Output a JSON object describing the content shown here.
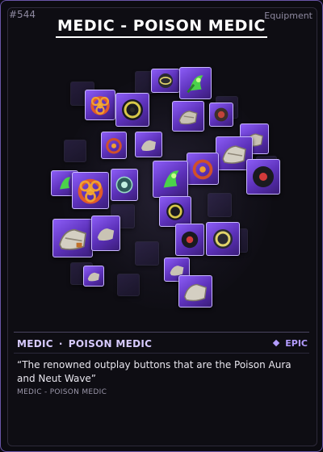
{
  "card": {
    "number": "#544",
    "type": "Equipment",
    "title": "MEDIC - POISON MEDIC",
    "class_name": "MEDIC",
    "subclass_name": "POISON MEDIC",
    "separator": "·",
    "rarity": "EPIC",
    "rarity_icon": "diamond-icon",
    "flavor_text": "“The renowned outplay buttons that are the Poison Aura and Neut Wave”",
    "subtag": "MEDIC - POISON MEDIC"
  },
  "colors": {
    "frame_border": "#6a55a8",
    "accent": "#b39cff",
    "tile_purple": "#6b3fd1",
    "background": "#0c0b11"
  },
  "art": {
    "description_icons": [
      "biohazard-icon",
      "gas-grenade-icon",
      "glove-icon",
      "green-creature-icon",
      "rune-orb-icon"
    ]
  }
}
